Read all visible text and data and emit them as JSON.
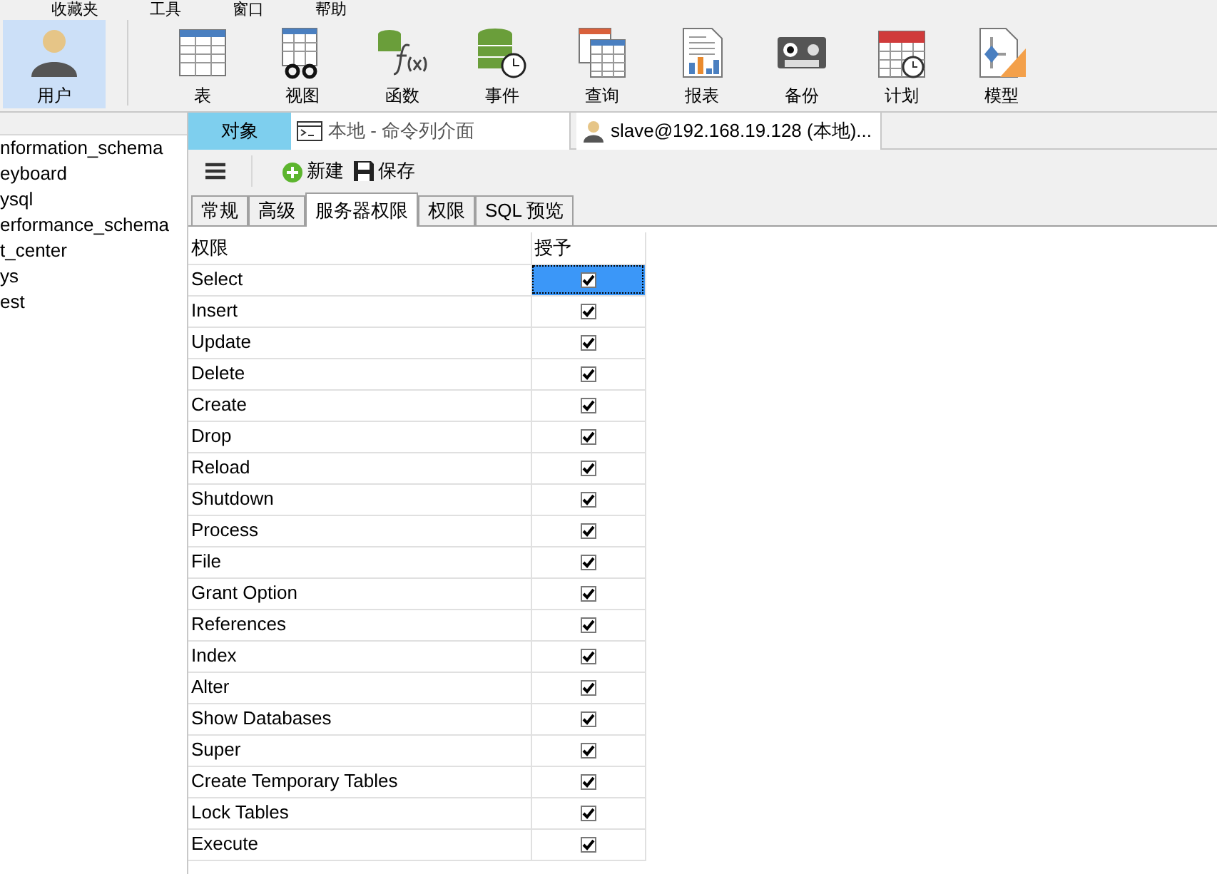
{
  "menu": [
    "收藏夹",
    "工具",
    "窗口",
    "帮助"
  ],
  "toolbar": [
    {
      "label": "用户",
      "kind": "user",
      "selected": true
    },
    {
      "label": "表",
      "kind": "table",
      "selected": false
    },
    {
      "label": "视图",
      "kind": "view",
      "selected": false
    },
    {
      "label": "函数",
      "kind": "function",
      "selected": false
    },
    {
      "label": "事件",
      "kind": "event",
      "selected": false
    },
    {
      "label": "查询",
      "kind": "query",
      "selected": false
    },
    {
      "label": "报表",
      "kind": "report",
      "selected": false
    },
    {
      "label": "备份",
      "kind": "backup",
      "selected": false
    },
    {
      "label": "计划",
      "kind": "schedule",
      "selected": false
    },
    {
      "label": "模型",
      "kind": "model",
      "selected": false
    }
  ],
  "sidebar": {
    "items": [
      "nformation_schema",
      "eyboard",
      "ysql",
      "erformance_schema",
      "t_center",
      "ys",
      "est"
    ]
  },
  "doc_tabs": [
    {
      "label": "对象",
      "kind": "plain",
      "selected": true
    },
    {
      "label": "本地 - 命令列介面",
      "kind": "console",
      "selected": false
    },
    {
      "label": "slave@192.168.19.128 (本地)...",
      "kind": "user",
      "selected": false
    }
  ],
  "actions": [
    "新建",
    "保存"
  ],
  "tabs": [
    {
      "label": "常规",
      "selected": false
    },
    {
      "label": "高级",
      "selected": false
    },
    {
      "label": "服务器权限",
      "selected": true
    },
    {
      "label": "权限",
      "selected": false
    },
    {
      "label": "SQL 预览",
      "selected": false
    }
  ],
  "table": {
    "columns": [
      "权限",
      "授予"
    ],
    "rows": [
      {
        "name": "Select",
        "granted": true,
        "selected": true
      },
      {
        "name": "Insert",
        "granted": true,
        "selected": false
      },
      {
        "name": "Update",
        "granted": true,
        "selected": false
      },
      {
        "name": "Delete",
        "granted": true,
        "selected": false
      },
      {
        "name": "Create",
        "granted": true,
        "selected": false
      },
      {
        "name": "Drop",
        "granted": true,
        "selected": false
      },
      {
        "name": "Reload",
        "granted": true,
        "selected": false
      },
      {
        "name": "Shutdown",
        "granted": true,
        "selected": false
      },
      {
        "name": "Process",
        "granted": true,
        "selected": false
      },
      {
        "name": "File",
        "granted": true,
        "selected": false
      },
      {
        "name": "Grant Option",
        "granted": true,
        "selected": false
      },
      {
        "name": "References",
        "granted": true,
        "selected": false
      },
      {
        "name": "Index",
        "granted": true,
        "selected": false
      },
      {
        "name": "Alter",
        "granted": true,
        "selected": false
      },
      {
        "name": "Show Databases",
        "granted": true,
        "selected": false
      },
      {
        "name": "Super",
        "granted": true,
        "selected": false
      },
      {
        "name": "Create Temporary Tables",
        "granted": true,
        "selected": false
      },
      {
        "name": "Lock Tables",
        "granted": true,
        "selected": false
      },
      {
        "name": "Execute",
        "granted": true,
        "selected": false
      }
    ]
  }
}
